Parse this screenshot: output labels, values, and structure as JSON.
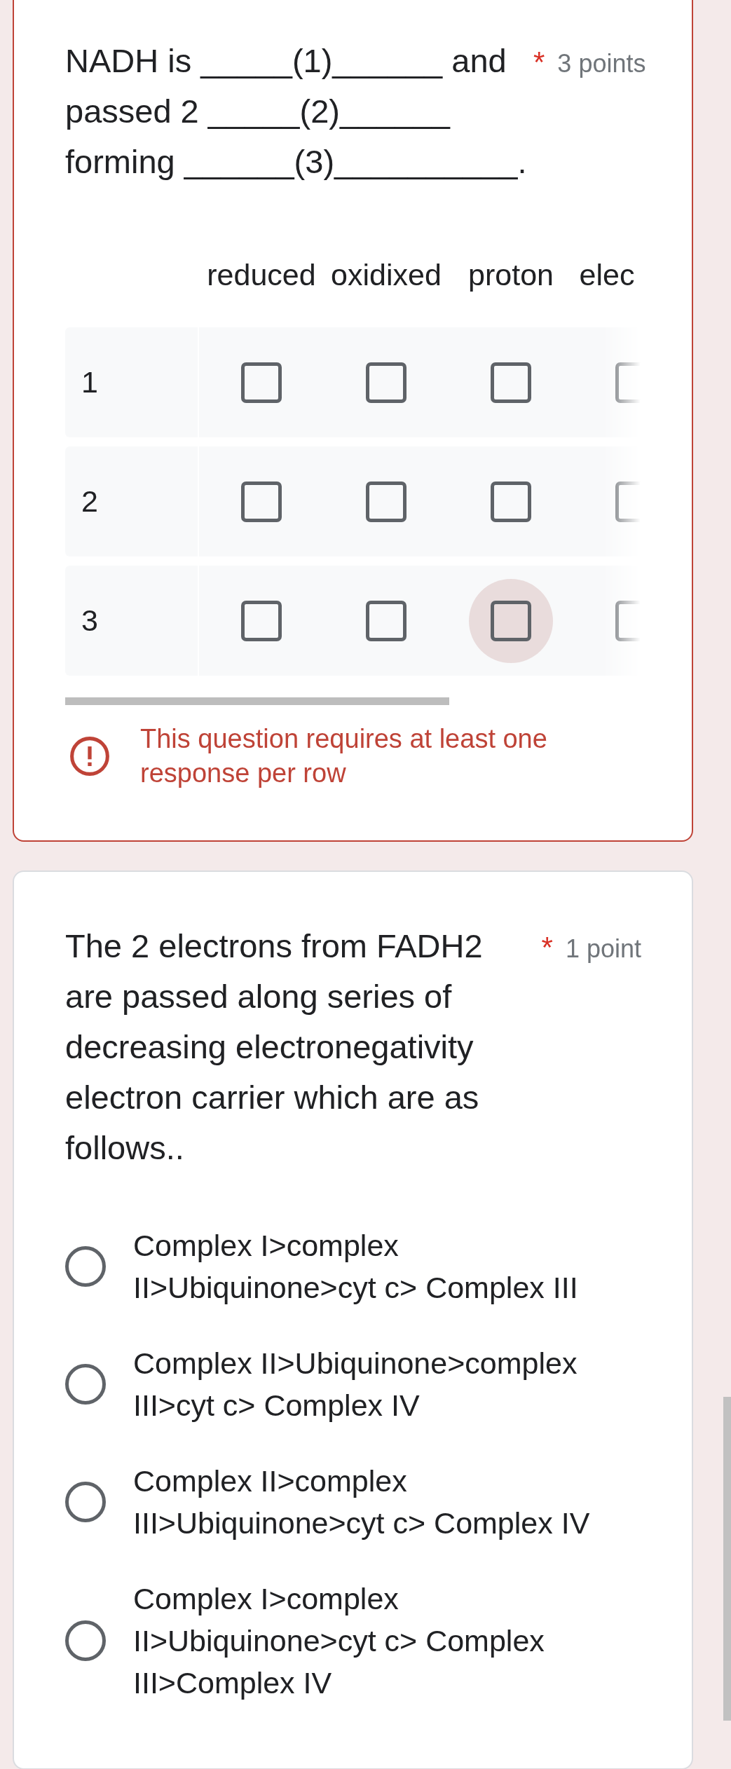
{
  "questions": [
    {
      "kind": "grid",
      "text": "NADH is _____(1)______ and passed 2 _____(2)______ forming ______(3)__________.",
      "required_mark": "*",
      "points": "3 points",
      "columns": [
        "reduced",
        "oxidixed",
        "proton",
        "elec"
      ],
      "rows": [
        {
          "label": "1",
          "cells": [
            {
              "checked": false,
              "focused": false
            },
            {
              "checked": false,
              "focused": false
            },
            {
              "checked": false,
              "focused": false
            },
            {
              "checked": false,
              "focused": false
            }
          ]
        },
        {
          "label": "2",
          "cells": [
            {
              "checked": false,
              "focused": false
            },
            {
              "checked": false,
              "focused": false
            },
            {
              "checked": false,
              "focused": false
            },
            {
              "checked": false,
              "focused": false
            }
          ]
        },
        {
          "label": "3",
          "cells": [
            {
              "checked": false,
              "focused": false
            },
            {
              "checked": false,
              "focused": false
            },
            {
              "checked": false,
              "focused": true
            },
            {
              "checked": false,
              "focused": false
            }
          ]
        }
      ],
      "error": "This question requires at least one response per row"
    },
    {
      "kind": "choice",
      "text": "The 2 electrons from FADH2 are passed along series of decreasing electronegativity electron carrier which are as follows..",
      "required_mark": "*",
      "points": "1 point",
      "options": [
        {
          "label": "Complex I>complex II>Ubiquinone>cyt c> Complex III",
          "selected": false
        },
        {
          "label": "Complex II>Ubiquinone>complex III>cyt c> Complex IV",
          "selected": false
        },
        {
          "label": "Complex II>complex III>Ubiquinone>cyt c> Complex IV",
          "selected": false
        },
        {
          "label": "Complex I>complex II>Ubiquinone>cyt c> Complex III>Complex IV",
          "selected": false
        }
      ]
    }
  ]
}
